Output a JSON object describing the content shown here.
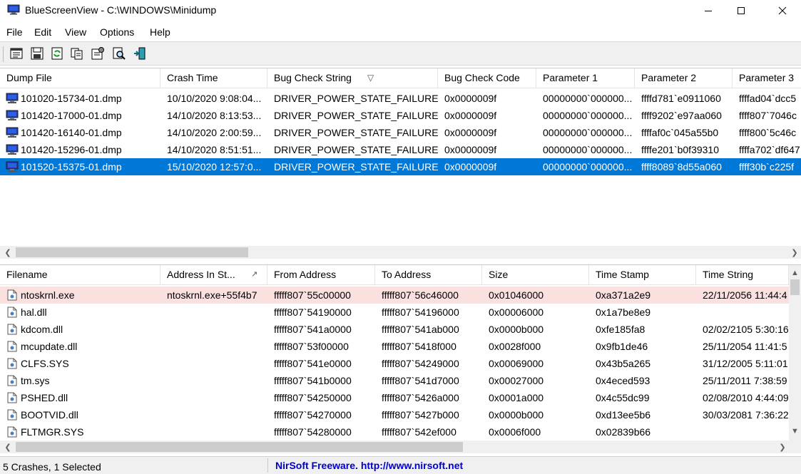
{
  "window": {
    "title": "BlueScreenView  -  C:\\WINDOWS\\Minidump",
    "icon": "monitor-icon"
  },
  "menu": [
    "File",
    "Edit",
    "View",
    "Options",
    "Help"
  ],
  "toolbar": {
    "buttons": [
      "properties-icon",
      "save-icon",
      "refresh-icon",
      "copy-icon",
      "advanced-options-icon",
      "find-icon",
      "exit-icon"
    ]
  },
  "crash_list": {
    "columns": [
      "Dump File",
      "Crash Time",
      "Bug Check String",
      "Bug Check Code",
      "Parameter 1",
      "Parameter 2",
      "Parameter 3"
    ],
    "sort_indicator": "▽",
    "rows": [
      {
        "dump_file": "101020-15734-01.dmp",
        "crash_time": "10/10/2020 9:08:04...",
        "bug_check_string": "DRIVER_POWER_STATE_FAILURE",
        "bug_check_code": "0x0000009f",
        "parameter1": "00000000`000000...",
        "parameter2": "ffffd781`e0911060",
        "parameter3": "ffffad04`dcc5"
      },
      {
        "dump_file": "101420-17000-01.dmp",
        "crash_time": "14/10/2020 8:13:53...",
        "bug_check_string": "DRIVER_POWER_STATE_FAILURE",
        "bug_check_code": "0x0000009f",
        "parameter1": "00000000`000000...",
        "parameter2": "ffff9202`e97aa060",
        "parameter3": "ffff807`7046c"
      },
      {
        "dump_file": "101420-16140-01.dmp",
        "crash_time": "14/10/2020 2:00:59...",
        "bug_check_string": "DRIVER_POWER_STATE_FAILURE",
        "bug_check_code": "0x0000009f",
        "parameter1": "00000000`000000...",
        "parameter2": "ffffaf0c`045a55b0",
        "parameter3": "ffff800`5c46c"
      },
      {
        "dump_file": "101420-15296-01.dmp",
        "crash_time": "14/10/2020 8:51:51...",
        "bug_check_string": "DRIVER_POWER_STATE_FAILURE",
        "bug_check_code": "0x0000009f",
        "parameter1": "00000000`000000...",
        "parameter2": "ffffe201`b0f39310",
        "parameter3": "ffffa702`df647"
      },
      {
        "dump_file": "101520-15375-01.dmp",
        "crash_time": "15/10/2020 12:57:0...",
        "bug_check_string": "DRIVER_POWER_STATE_FAILURE",
        "bug_check_code": "0x0000009f",
        "parameter1": "00000000`000000...",
        "parameter2": "ffff8089`8d55a060",
        "parameter3": "ffff30b`c225f",
        "selected": true
      }
    ]
  },
  "driver_list": {
    "columns": [
      "Filename",
      "Address In St...",
      "From Address",
      "To Address",
      "Size",
      "Time Stamp",
      "Time String"
    ],
    "sort_indicator": "↗",
    "rows": [
      {
        "filename": "ntoskrnl.exe",
        "address_in_stack": "ntoskrnl.exe+55f4b7",
        "from": "fffff807`55c00000",
        "to": "fffff807`56c46000",
        "size": "0x01046000",
        "time_stamp": "0xa371a2e9",
        "time_string": "22/11/2056 11:44:4",
        "highlight": true
      },
      {
        "filename": "hal.dll",
        "address_in_stack": "",
        "from": "fffff807`54190000",
        "to": "fffff807`54196000",
        "size": "0x00006000",
        "time_stamp": "0x1a7be8e9",
        "time_string": ""
      },
      {
        "filename": "kdcom.dll",
        "address_in_stack": "",
        "from": "fffff807`541a0000",
        "to": "fffff807`541ab000",
        "size": "0x0000b000",
        "time_stamp": "0xfe185fa8",
        "time_string": "02/02/2105 5:30:16"
      },
      {
        "filename": "mcupdate.dll",
        "address_in_stack": "",
        "from": "fffff807`53f00000",
        "to": "fffff807`5418f000",
        "size": "0x0028f000",
        "time_stamp": "0x9fb1de46",
        "time_string": "25/11/2054 11:41:5"
      },
      {
        "filename": "CLFS.SYS",
        "address_in_stack": "",
        "from": "fffff807`541e0000",
        "to": "fffff807`54249000",
        "size": "0x00069000",
        "time_stamp": "0x43b5a265",
        "time_string": "31/12/2005 5:11:01"
      },
      {
        "filename": "tm.sys",
        "address_in_stack": "",
        "from": "fffff807`541b0000",
        "to": "fffff807`541d7000",
        "size": "0x00027000",
        "time_stamp": "0x4eced593",
        "time_string": "25/11/2011 7:38:59"
      },
      {
        "filename": "PSHED.dll",
        "address_in_stack": "",
        "from": "fffff807`54250000",
        "to": "fffff807`5426a000",
        "size": "0x0001a000",
        "time_stamp": "0x4c55dc99",
        "time_string": "02/08/2010 4:44:09"
      },
      {
        "filename": "BOOTVID.dll",
        "address_in_stack": "",
        "from": "fffff807`54270000",
        "to": "fffff807`5427b000",
        "size": "0x0000b000",
        "time_stamp": "0xd13ee5b6",
        "time_string": "30/03/2081 7:36:22"
      },
      {
        "filename": "FLTMGR.SYS",
        "address_in_stack": "",
        "from": "fffff807`54280000",
        "to": "fffff807`542ef000",
        "size": "0x0006f000",
        "time_stamp": "0x02839b66",
        "time_string": ""
      }
    ]
  },
  "statusbar": {
    "left": "5 Crashes, 1 Selected",
    "right": "NirSoft Freeware.  http://www.nirsoft.net"
  },
  "colors": {
    "selection": "#0078d7",
    "highlight_row": "#fbe0e0",
    "link_blue": "#0000cc",
    "toolbar_bg": "#f0f0f0"
  }
}
